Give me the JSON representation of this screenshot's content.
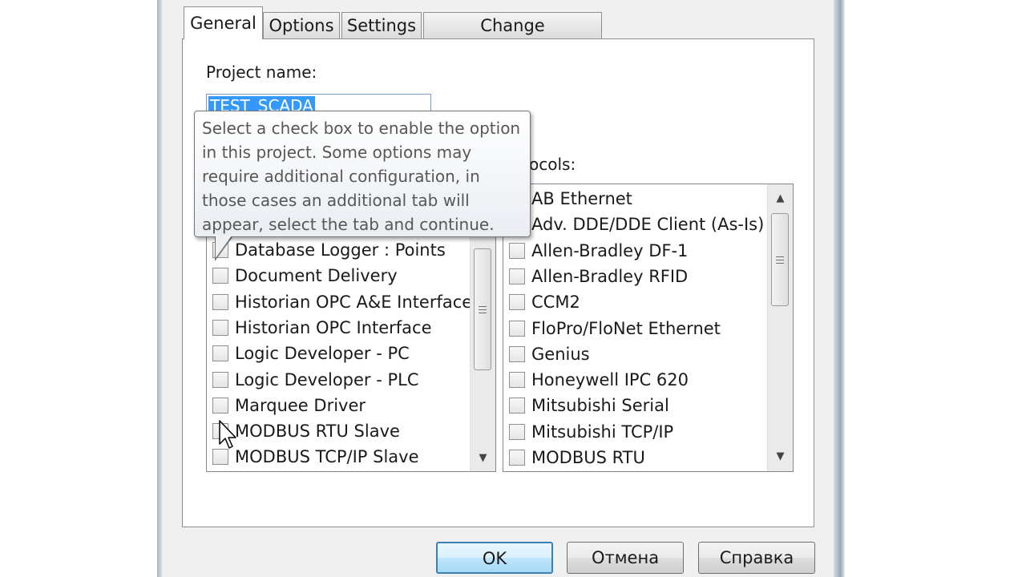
{
  "tabs": [
    {
      "label": "General",
      "active": true
    },
    {
      "label": "Options",
      "active": false
    },
    {
      "label": "Settings",
      "active": false
    },
    {
      "label": "Change Management",
      "active": false
    }
  ],
  "project_name": {
    "label": "Project name:",
    "value": "TEST_SCADA"
  },
  "protocols_label_partial": "ocols:",
  "tooltip": "Select a check box to enable the option in this project.  Some options may require additional configuration, in those cases an additional tab will appear, select the tab and continue.",
  "options_list": {
    "items": [
      {
        "label": "Database Logger : Points",
        "checked": false
      },
      {
        "label": "Document Delivery",
        "checked": false
      },
      {
        "label": "Historian OPC A&E Interface",
        "checked": false
      },
      {
        "label": "Historian OPC Interface",
        "checked": false
      },
      {
        "label": "Logic Developer - PC",
        "checked": false
      },
      {
        "label": "Logic Developer - PLC",
        "checked": false
      },
      {
        "label": "Marquee Driver",
        "checked": false
      },
      {
        "label": "MODBUS RTU Slave",
        "checked": false
      },
      {
        "label": "MODBUS TCP/IP Slave",
        "checked": false
      }
    ]
  },
  "protocols_list": {
    "items": [
      {
        "label": "AB Ethernet",
        "checked": false
      },
      {
        "label": "Adv. DDE/DDE Client (As-Is)",
        "checked": false
      },
      {
        "label": "Allen-Bradley DF-1",
        "checked": false
      },
      {
        "label": "Allen-Bradley RFID",
        "checked": false
      },
      {
        "label": "CCM2",
        "checked": false
      },
      {
        "label": "FloPro/FloNet Ethernet",
        "checked": false
      },
      {
        "label": "Genius",
        "checked": false
      },
      {
        "label": "Honeywell IPC 620",
        "checked": false
      },
      {
        "label": "Mitsubishi Serial",
        "checked": false
      },
      {
        "label": "Mitsubishi TCP/IP",
        "checked": false
      },
      {
        "label": "MODBUS RTU",
        "checked": false
      }
    ]
  },
  "buttons": {
    "ok": "OK",
    "cancel": "Отмена",
    "help": "Справка"
  },
  "icons": {
    "scroll_up": "scroll-up-arrow-icon",
    "scroll_down": "scroll-down-arrow-icon",
    "cursor": "mouse-pointer-icon"
  }
}
